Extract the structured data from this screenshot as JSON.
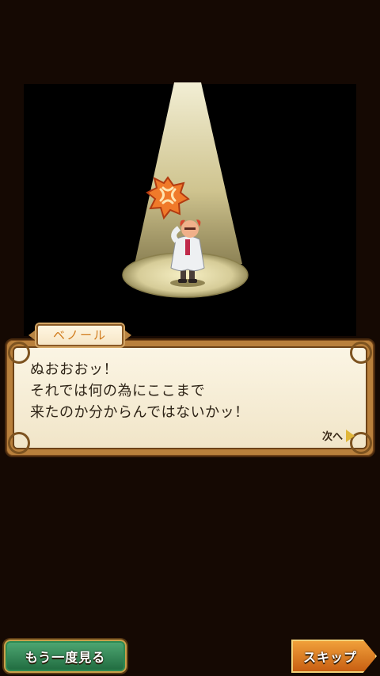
{
  "speaker": "ベノール",
  "dialogue": {
    "lines": [
      "ぬおおおッ！",
      "それでは何の為にここまで",
      "来たのか分からんではないかッ！"
    ],
    "next_label": "次へ"
  },
  "buttons": {
    "replay_label": "もう一度見る",
    "skip_label": "スキップ"
  },
  "colors": {
    "background": "#150903",
    "spotlight": "#fff3c0",
    "dialog_frame": "#b9803c",
    "replay_button": "#2f8a55",
    "skip_button": "#e08a2a"
  },
  "icons": [
    "anger-emote-icon",
    "next-arrow-icon"
  ]
}
